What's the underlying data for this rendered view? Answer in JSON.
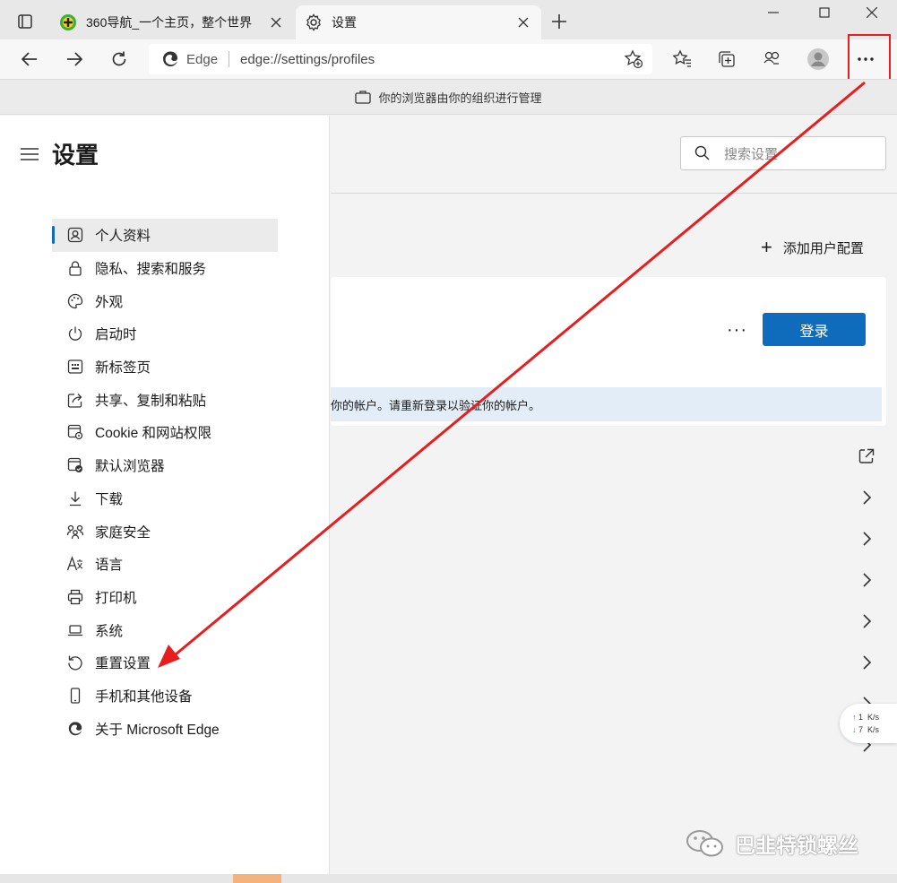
{
  "tabs": [
    {
      "title": "360导航_一个主页，整个世界"
    },
    {
      "title": "设置"
    }
  ],
  "address": {
    "site_name": "Edge",
    "url": "edge://settings/profiles"
  },
  "infobar": {
    "text": "你的浏览器由你的组织进行管理"
  },
  "sidebar": {
    "heading": "设置",
    "items": [
      {
        "label": "个人资料",
        "icon": "profile-icon"
      },
      {
        "label": "隐私、搜索和服务",
        "icon": "lock-icon"
      },
      {
        "label": "外观",
        "icon": "palette-icon"
      },
      {
        "label": "启动时",
        "icon": "power-icon"
      },
      {
        "label": "新标签页",
        "icon": "new-tab-page-icon"
      },
      {
        "label": "共享、复制和粘贴",
        "icon": "share-icon"
      },
      {
        "label": "Cookie 和网站权限",
        "icon": "cookie-icon"
      },
      {
        "label": "默认浏览器",
        "icon": "default-browser-icon"
      },
      {
        "label": "下载",
        "icon": "download-icon"
      },
      {
        "label": "家庭安全",
        "icon": "family-icon"
      },
      {
        "label": "语言",
        "icon": "language-icon"
      },
      {
        "label": "打印机",
        "icon": "printer-icon"
      },
      {
        "label": "系统",
        "icon": "laptop-icon"
      },
      {
        "label": "重置设置",
        "icon": "reset-icon"
      },
      {
        "label": "手机和其他设备",
        "icon": "phone-icon"
      },
      {
        "label": "关于 Microsoft Edge",
        "icon": "edge-logo-icon"
      }
    ]
  },
  "main": {
    "search_placeholder": "搜索设置",
    "add_profile_label": "添加用户配置",
    "login_button": "登录",
    "more_label": "···",
    "notice_text": "你的帐户。请重新登录以验证你的帐户。"
  },
  "net_widget": {
    "up_value": "1",
    "down_value": "7",
    "unit": "K/s"
  },
  "watermark": {
    "text": "巴韭特锁螺丝"
  },
  "colors": {
    "accent": "#0f6cbd",
    "annotation": "#e81e1e"
  }
}
